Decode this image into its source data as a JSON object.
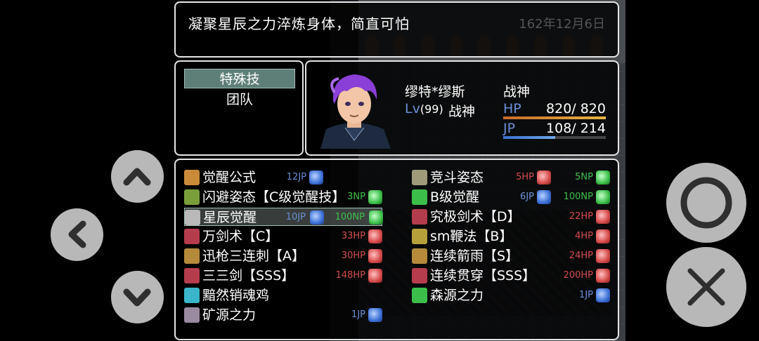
{
  "help": {
    "text": "凝聚星辰之力淬炼身体，简直可怕",
    "date": "162年12月6日"
  },
  "commands": [
    {
      "label": "特殊技",
      "selected": true
    },
    {
      "label": "团队",
      "selected": false
    }
  ],
  "actor": {
    "name": "缪特*缪斯",
    "title": "战神",
    "lv_label": "Lv",
    "level": "(99)",
    "class": "战神",
    "hp_label": "HP",
    "hp": "820/ 820",
    "jp_label": "JP",
    "jp": "108/ 214",
    "hp_fill": 1.0,
    "jp_fill": 0.505
  },
  "skills_left": [
    {
      "name": "觉醒公式",
      "icon": "formula-icon",
      "cost1": "12JP",
      "gem1": "blue",
      "cost2": "",
      "gem2": ""
    },
    {
      "name": "闪避姿态【C级觉醒技】",
      "icon": "wind-icon",
      "cost1": "",
      "gem1": "",
      "cost2": "3NP",
      "gem2": "green"
    },
    {
      "name": "星辰觉醒",
      "icon": "star-icon",
      "cost1": "10JP",
      "gem1": "blue",
      "cost2": "100NP",
      "gem2": "green",
      "selected": true
    },
    {
      "name": "万剑术【C】",
      "icon": "sword-icon",
      "cost1": "",
      "gem1": "",
      "cost2": "33HP",
      "gem2": "red"
    },
    {
      "name": "迅枪三连刺【A】",
      "icon": "spear-icon",
      "cost1": "",
      "gem1": "",
      "cost2": "30HP",
      "gem2": "red"
    },
    {
      "name": "三三剑【SSS】",
      "icon": "sword-icon",
      "cost1": "",
      "gem1": "",
      "cost2": "148HP",
      "gem2": "red"
    },
    {
      "name": "黯然销魂鸡",
      "icon": "book-icon",
      "cost1": "",
      "gem1": "",
      "cost2": "",
      "gem2": ""
    },
    {
      "name": "矿源之力",
      "icon": "ore-icon",
      "cost1": "",
      "gem1": "",
      "cost2": "1JP",
      "gem2": "blue"
    }
  ],
  "skills_right": [
    {
      "name": "竞斗姿态",
      "icon": "gear-icon",
      "cost1": "5HP",
      "gem1": "red",
      "cost2": "5NP",
      "gem2": "green"
    },
    {
      "name": "B级觉醒",
      "icon": "orb-icon",
      "cost1": "6JP",
      "gem1": "blue",
      "cost2": "100NP",
      "gem2": "green"
    },
    {
      "name": "究极剑术【D】",
      "icon": "sword-icon",
      "cost1": "",
      "gem1": "",
      "cost2": "22HP",
      "gem2": "red"
    },
    {
      "name": "sm鞭法【B】",
      "icon": "whip-icon",
      "cost1": "",
      "gem1": "",
      "cost2": "4HP",
      "gem2": "red"
    },
    {
      "name": "连续箭雨【S】",
      "icon": "arrow-icon",
      "cost1": "",
      "gem1": "",
      "cost2": "24HP",
      "gem2": "red"
    },
    {
      "name": "连续贯穿【SSS】",
      "icon": "sword-icon",
      "cost1": "",
      "gem1": "",
      "cost2": "200HP",
      "gem2": "red"
    },
    {
      "name": "森源之力",
      "icon": "orb-icon",
      "cost1": "",
      "gem1": "",
      "cost2": "1JP",
      "gem2": "blue"
    }
  ],
  "colors": {
    "jp": "#6a8fd8",
    "hp": "#d44c4c",
    "np": "#3cbf4a",
    "selection": "#5e7f77"
  },
  "controls": [
    "up-button",
    "down-button",
    "left-button",
    "confirm-button",
    "cancel-button"
  ]
}
